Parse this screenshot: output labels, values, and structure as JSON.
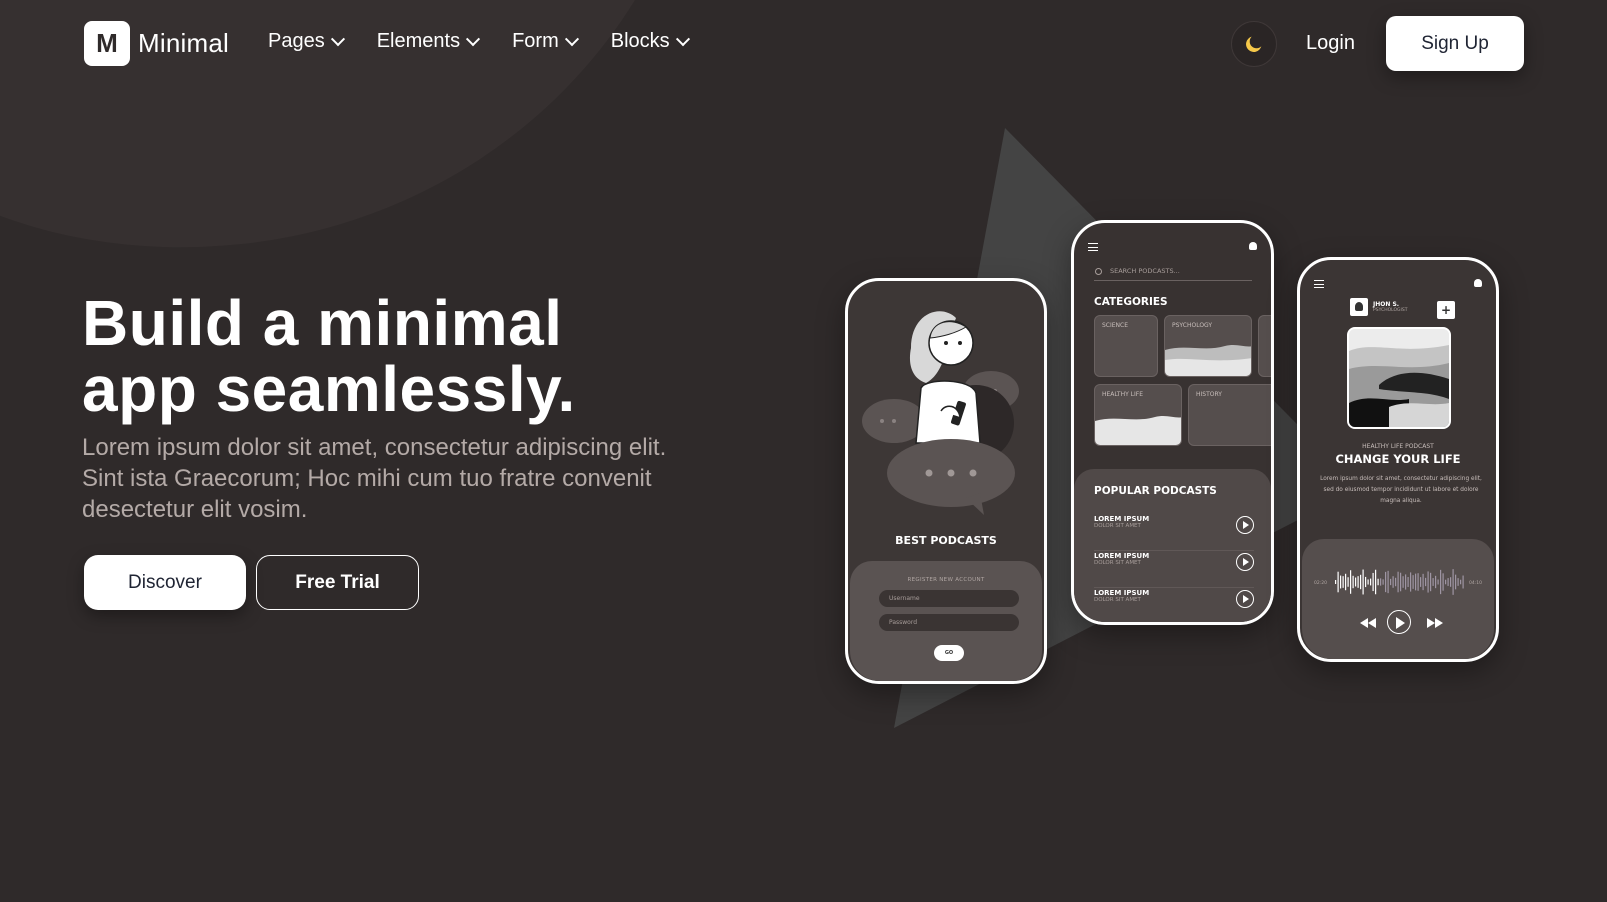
{
  "brand": {
    "logo_letter": "M",
    "name": "Minimal"
  },
  "nav": {
    "items": [
      {
        "label": "Pages"
      },
      {
        "label": "Elements"
      },
      {
        "label": "Form"
      },
      {
        "label": "Blocks"
      }
    ],
    "theme_icon": "moon-icon",
    "login_label": "Login",
    "signup_label": "Sign Up"
  },
  "hero": {
    "title_line1": "Build a minimal",
    "title_line2": "app seamlessly.",
    "subtitle": "Lorem ipsum dolor sit amet, consectetur adipiscing elit. Sint ista Graecorum; Hoc mihi cum tuo fratre convenit desectetur elit vosim.",
    "primary_button": "Discover",
    "secondary_button": "Free Trial"
  },
  "colors": {
    "background": "#2f2a2a",
    "surface": "#3d3736",
    "accent_moon": "#f5c84a",
    "text_muted": "#b4aaa7"
  },
  "mockups": {
    "phone1": {
      "title": "BEST PODCASTS",
      "register_title": "REGISTER NEW ACCOUNT",
      "username_placeholder": "Username",
      "password_placeholder": "Password",
      "go_label": "GO"
    },
    "phone2": {
      "search_placeholder": "SEARCH PODCASTS...",
      "categories_title": "CATEGORIES",
      "categories": [
        "SCIENCE",
        "PSYCHOLOGY",
        "HEALTHY LIFE",
        "HISTORY"
      ],
      "popular_title": "POPULAR PODCASTS",
      "podcasts": [
        {
          "title": "LOREM IPSUM",
          "subtitle": "DOLOR SIT AMET"
        },
        {
          "title": "LOREM IPSUM",
          "subtitle": "DOLOR SIT AMET"
        },
        {
          "title": "LOREM IPSUM",
          "subtitle": "DOLOR SIT AMET"
        }
      ]
    },
    "phone3": {
      "author_name": "JHON S.",
      "author_role": "PSYCHOLOGIST",
      "kicker": "HEALTHY LIFE PODCAST",
      "headline": "CHANGE YOUR LIFE",
      "description": "Lorem ipsum dolor sit amet, consectetur adipiscing elit, sed do eiusmod tempor incididunt ut labore et dolore magna aliqua.",
      "time_elapsed": "02:20",
      "time_total": "04:10"
    }
  }
}
